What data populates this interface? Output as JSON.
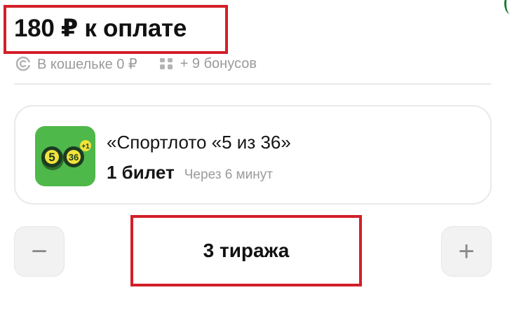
{
  "payment": {
    "total_label": "180 ₽ к оплате",
    "wallet_icon": "wallet-icon",
    "wallet_text": "В кошельке 0 ₽",
    "bonus_icon": "bonus-icon",
    "bonus_text": "+ 9 бонусов"
  },
  "ticket": {
    "logo_icon": "sportloto-5-of-36-logo",
    "logo_balls": [
      "5",
      "36"
    ],
    "logo_badge": "+1",
    "title": "«Спортлото «5 из 36»",
    "count": "1 билет",
    "draw_time": "Через 6 минут"
  },
  "draws": {
    "decrement_label": "−",
    "value": "3 тиража",
    "increment_label": "+"
  },
  "colors": {
    "highlight": "#d31f2a",
    "logo_green": "#4fb84a",
    "ball_yellow": "#f2e33b",
    "ball_dark": "#1b3b22",
    "muted_text": "#9a9a9a"
  }
}
